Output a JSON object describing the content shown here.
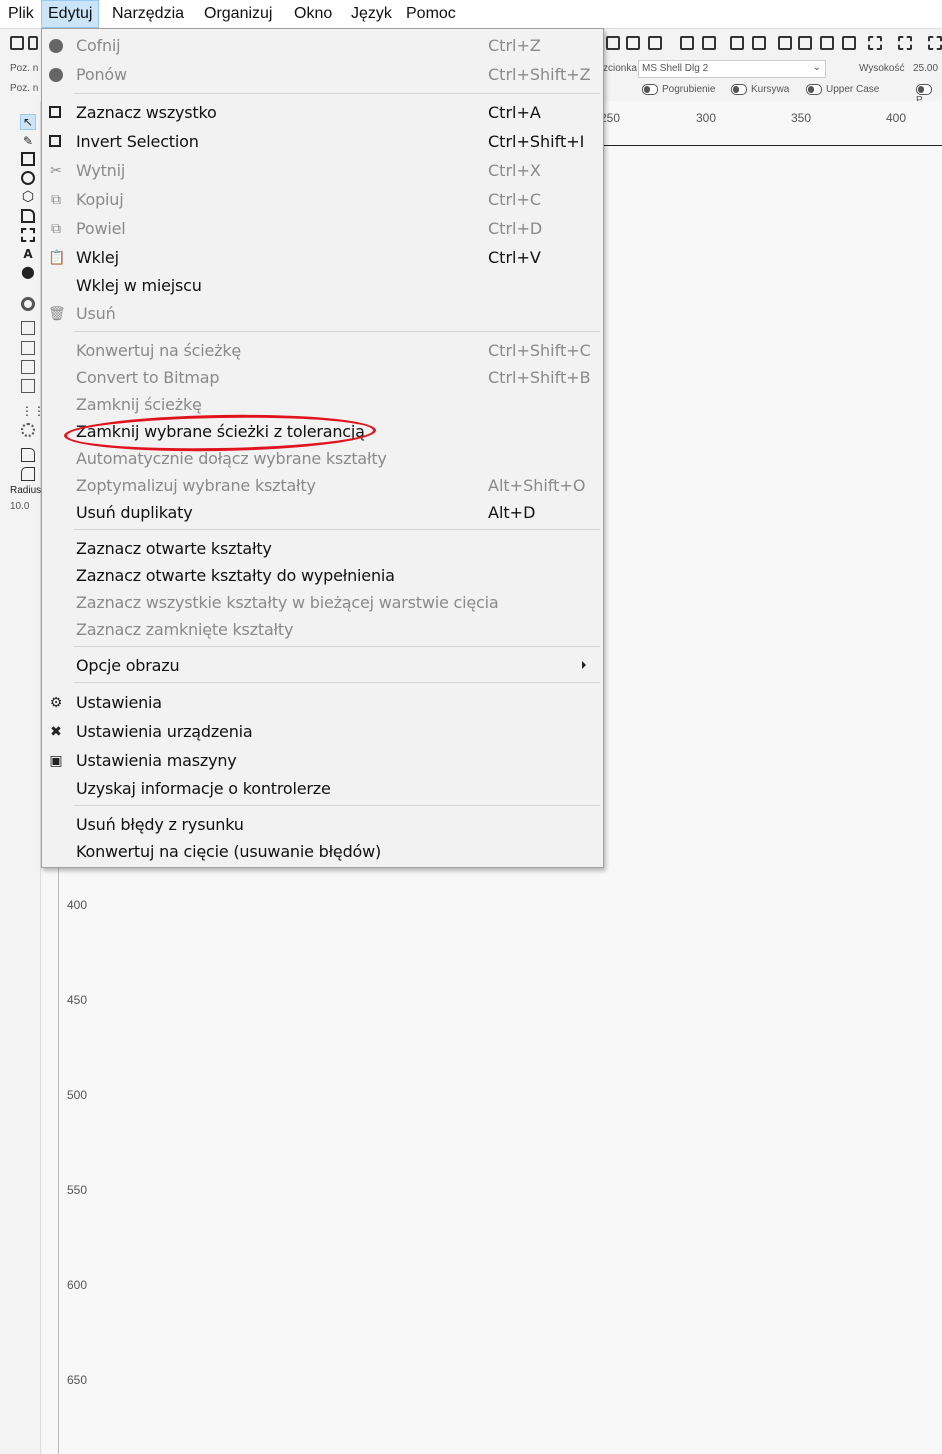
{
  "menubar": {
    "items": [
      {
        "label": "Plik"
      },
      {
        "label": "Edytuj"
      },
      {
        "label": "Narzędzia"
      },
      {
        "label": "Organizuj"
      },
      {
        "label": "Okno"
      },
      {
        "label": "Język"
      },
      {
        "label": "Pomoc"
      }
    ],
    "active": "Edytuj"
  },
  "propbar": {
    "pos_label_1": "Poz. n",
    "pos_label_2": "Poz. n",
    "font_label": "zcionka",
    "font_value": "MS Shell Dlg 2",
    "height_label": "Wysokość",
    "height_value": "25.00",
    "toggles": [
      "Pogrubienie",
      "Kursywa",
      "Upper Case",
      "P"
    ]
  },
  "lefttools": {
    "radius_label": "Radius",
    "radius_value": "10.0"
  },
  "hruler": {
    "ticks": [
      "250",
      "300",
      "350",
      "400"
    ]
  },
  "vruler": {
    "ticks": [
      "400",
      "450",
      "500",
      "550",
      "600",
      "650"
    ]
  },
  "edit_menu": {
    "items": [
      {
        "label": "Cofnij",
        "shortcut": "Ctrl+Z",
        "disabled": true,
        "icon": "undo-icon"
      },
      {
        "label": "Ponów",
        "shortcut": "Ctrl+Shift+Z",
        "disabled": true,
        "icon": "redo-icon"
      },
      {
        "label": "Zaznacz wszystko",
        "shortcut": "Ctrl+A",
        "disabled": false,
        "icon": "select-all-icon"
      },
      {
        "label": "Invert Selection",
        "shortcut": "Ctrl+Shift+I",
        "disabled": false,
        "icon": "invert-selection-icon"
      },
      {
        "label": "Wytnij",
        "shortcut": "Ctrl+X",
        "disabled": true,
        "icon": "scissors-icon"
      },
      {
        "label": "Kopiuj",
        "shortcut": "Ctrl+C",
        "disabled": true,
        "icon": "copy-icon"
      },
      {
        "label": "Powiel",
        "shortcut": "Ctrl+D",
        "disabled": true,
        "icon": "duplicate-icon"
      },
      {
        "label": "Wklej",
        "shortcut": "Ctrl+V",
        "disabled": false,
        "icon": "paste-icon"
      },
      {
        "label": "Wklej w miejscu",
        "shortcut": "",
        "disabled": false,
        "icon": ""
      },
      {
        "label": "Usuń",
        "shortcut": "",
        "disabled": true,
        "icon": "trash-icon"
      },
      {
        "label": "Konwertuj na ścieżkę",
        "shortcut": "Ctrl+Shift+C",
        "disabled": true,
        "icon": ""
      },
      {
        "label": "Convert to Bitmap",
        "shortcut": "Ctrl+Shift+B",
        "disabled": true,
        "icon": ""
      },
      {
        "label": "Zamknij ścieżkę",
        "shortcut": "",
        "disabled": true,
        "icon": ""
      },
      {
        "label": "Zamknij wybrane ścieżki z tolerancją",
        "shortcut": "",
        "disabled": false,
        "icon": ""
      },
      {
        "label": "Automatycznie dołącz wybrane kształty",
        "shortcut": "",
        "disabled": true,
        "icon": ""
      },
      {
        "label": "Zoptymalizuj wybrane kształty",
        "shortcut": "Alt+Shift+O",
        "disabled": true,
        "icon": ""
      },
      {
        "label": "Usuń duplikaty",
        "shortcut": "Alt+D",
        "disabled": false,
        "icon": ""
      },
      {
        "label": "Zaznacz otwarte kształty",
        "shortcut": "",
        "disabled": false,
        "icon": ""
      },
      {
        "label": "Zaznacz otwarte kształty do wypełnienia",
        "shortcut": "",
        "disabled": false,
        "icon": ""
      },
      {
        "label": "Zaznacz wszystkie kształty w bieżącej warstwie cięcia",
        "shortcut": "",
        "disabled": true,
        "icon": ""
      },
      {
        "label": "Zaznacz zamknięte kształty",
        "shortcut": "",
        "disabled": true,
        "icon": ""
      },
      {
        "label": "Opcje obrazu",
        "shortcut": "",
        "disabled": false,
        "icon": "",
        "submenu": true
      },
      {
        "label": "Ustawienia",
        "shortcut": "",
        "disabled": false,
        "icon": "gears-icon"
      },
      {
        "label": "Ustawienia urządzenia",
        "shortcut": "",
        "disabled": false,
        "icon": "tools-icon"
      },
      {
        "label": "Ustawienia maszyny",
        "shortcut": "",
        "disabled": false,
        "icon": "machine-icon"
      },
      {
        "label": "Uzyskaj informacje o kontrolerze",
        "shortcut": "",
        "disabled": false,
        "icon": ""
      },
      {
        "label": "Usuń błędy z rysunku",
        "shortcut": "",
        "disabled": false,
        "icon": ""
      },
      {
        "label": "Konwertuj na cięcie (usuwanie błędów)",
        "shortcut": "",
        "disabled": false,
        "icon": ""
      }
    ],
    "highlight_color": "#e0141e"
  }
}
